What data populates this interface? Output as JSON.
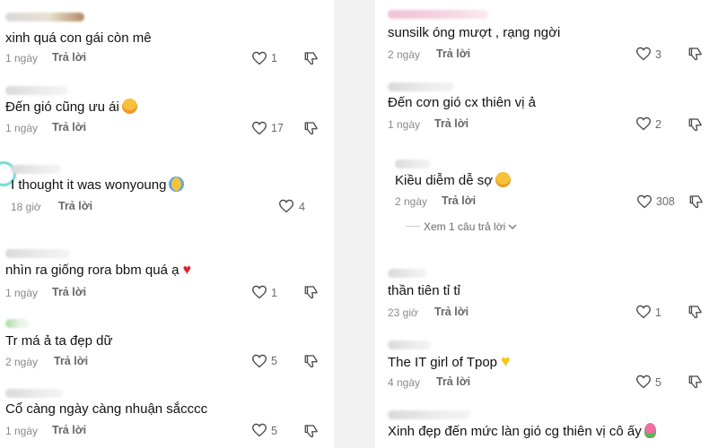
{
  "left": [
    {
      "text": "xinh quá con gái còn mê",
      "time": "1 ngày",
      "reply": "Trả lời",
      "likes": "1",
      "emoji": ""
    },
    {
      "text": "Đến gió cũng ưu ái",
      "time": "1 ngày",
      "reply": "Trả lời",
      "likes": "17",
      "emoji": "smiling-face-with-hearts"
    },
    {
      "text": "I thought it was wonyoung",
      "time": "18 giờ",
      "reply": "Trả lời",
      "likes": "4",
      "emoji": "loudly-crying-face"
    },
    {
      "text": "nhìn ra giống rora bbm quá ạ",
      "time": "1 ngày",
      "reply": "Trả lời",
      "likes": "1",
      "emoji": "red-heart"
    },
    {
      "text": "Tr má ả ta đẹp dữ",
      "time": "2 ngày",
      "reply": "Trả lời",
      "likes": "5",
      "emoji": ""
    },
    {
      "text": "Cổ càng ngày càng nhuận sắcccc",
      "time": "1 ngày",
      "reply": "Trả lời",
      "likes": "5",
      "emoji": ""
    }
  ],
  "right": [
    {
      "text": "sunsilk óng mượt , rạng ngời",
      "time": "2 ngày",
      "reply": "Trả lời",
      "likes": "3",
      "emoji": ""
    },
    {
      "text": "Đến cơn gió cx thiên vị ả",
      "time": "1 ngày",
      "reply": "Trả lời",
      "likes": "2",
      "emoji": ""
    },
    {
      "text": "Kiều diễm dễ sợ",
      "time": "2 ngày",
      "reply": "Trả lời",
      "likes": "308",
      "emoji": "pleading-face"
    },
    {
      "text": "thần tiên tỉ tỉ",
      "time": "23 giờ",
      "reply": "Trả lời",
      "likes": "1",
      "emoji": ""
    },
    {
      "text": "The IT girl of Tpop",
      "time": "4 ngày",
      "reply": "Trả lời",
      "likes": "5",
      "emoji": "yellow-heart"
    },
    {
      "text": "Xinh đẹp đến mức làn gió cg thiên vị cô ấy",
      "time": "",
      "reply": "",
      "likes": "",
      "emoji": "tulip"
    }
  ],
  "view_replies": "Xem 1 câu trả lời",
  "icons": {
    "like": "heart-outline-icon",
    "dislike": "thumbs-down-icon",
    "expand": "chevron-down-icon"
  },
  "colors": {
    "emoji_heart": "#e0252f",
    "emoji_yellow_heart": "#f5c518",
    "emoji_face": "#f7c23a"
  }
}
